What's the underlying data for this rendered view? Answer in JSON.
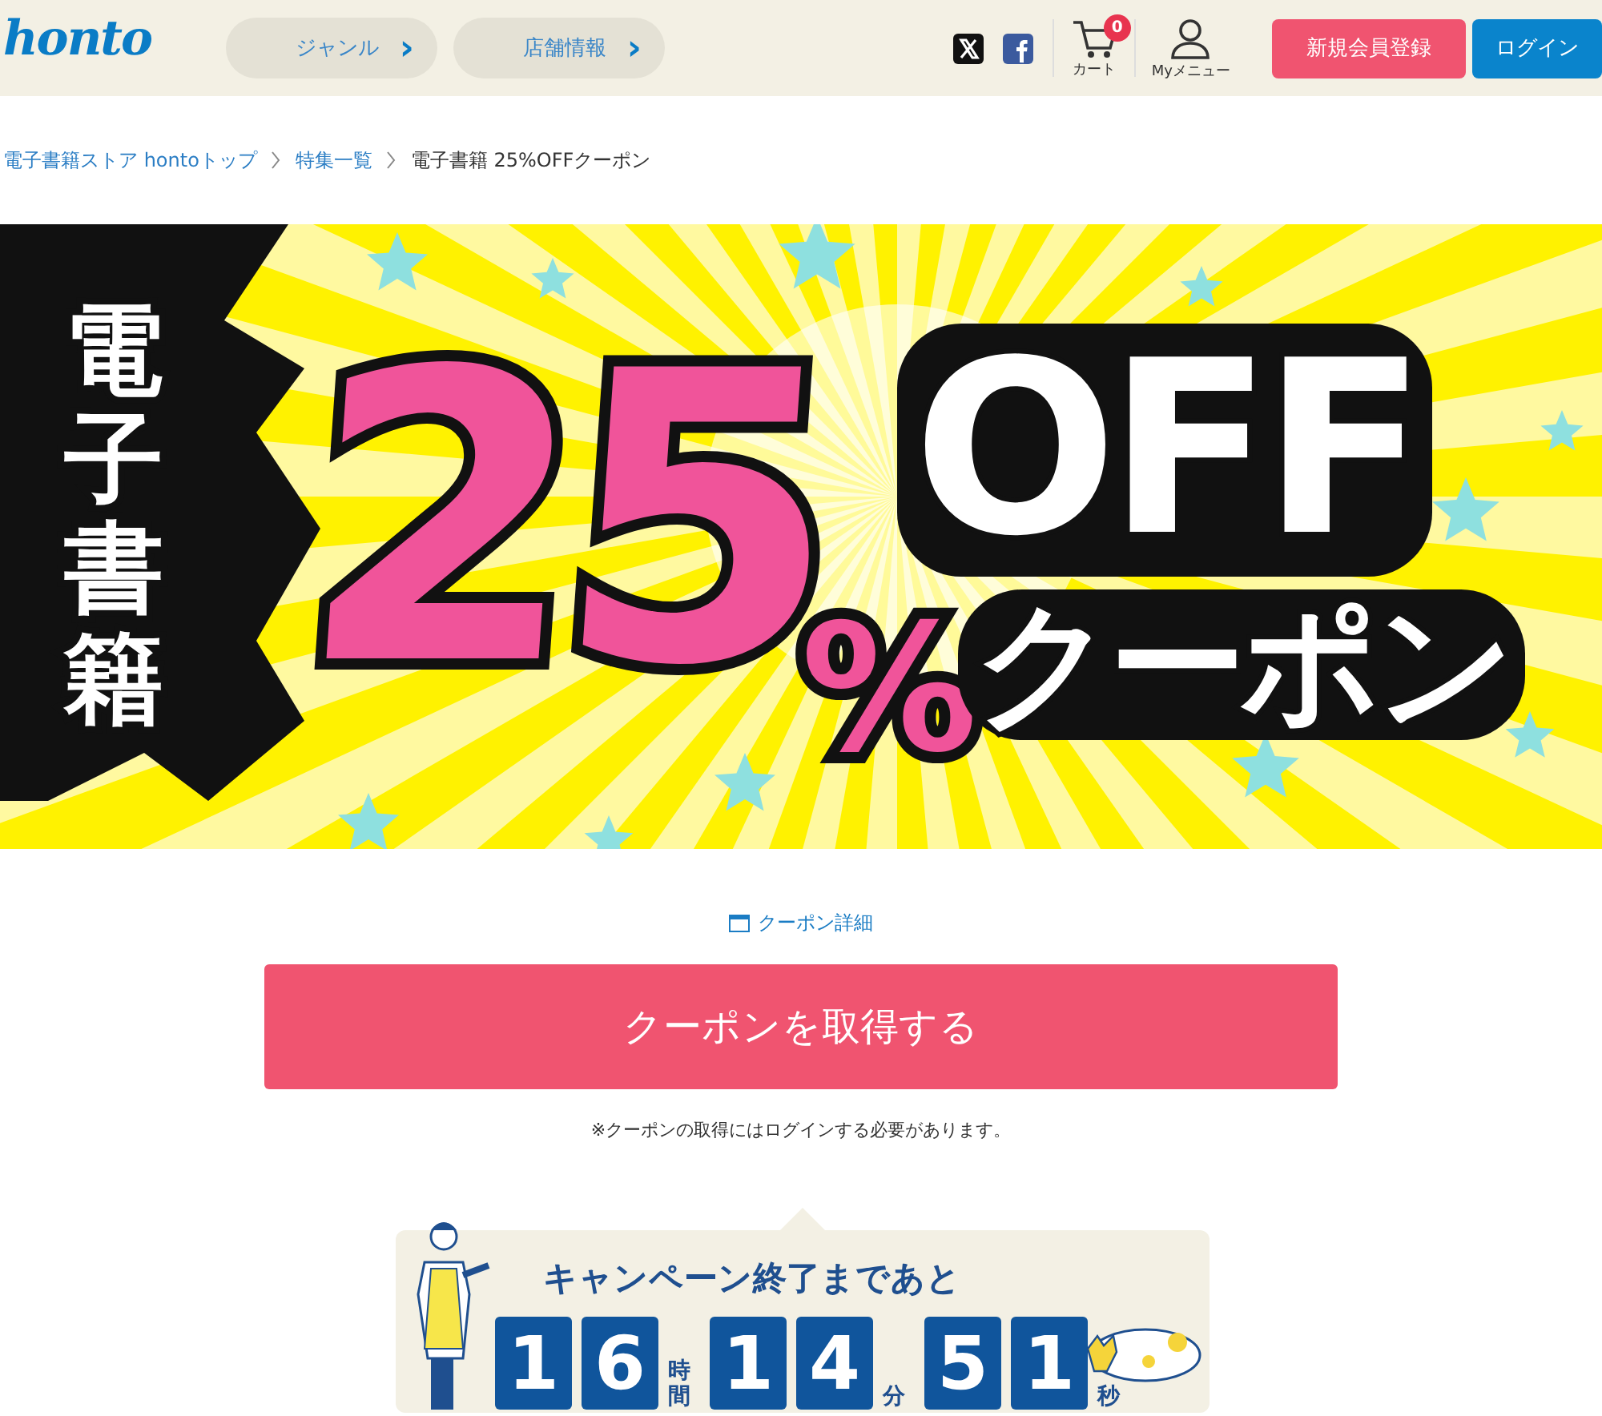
{
  "header": {
    "logo": "honto",
    "nav": [
      {
        "label": "ジャンル",
        "arrow": "›"
      },
      {
        "label": "店舗情報",
        "arrow": "›"
      }
    ],
    "cart": {
      "label": "カート",
      "count": "0"
    },
    "my_menu": {
      "label": "Myメニュー"
    },
    "buttons": [
      {
        "kind": "register",
        "label": "新規会員登録"
      },
      {
        "kind": "login",
        "label": "ログイン"
      }
    ]
  },
  "breadcrumb": [
    {
      "label": "電子書籍ストア hontoトップ",
      "link": true
    },
    {
      "label": "特集一覧",
      "link": true
    },
    {
      "label": "電子書籍 25%OFFクーポン",
      "link": false
    }
  ],
  "banner": {
    "vertical": "電子書籍",
    "number": "25",
    "percent": "%",
    "off": "OFF",
    "coupon": "クーポン"
  },
  "coupon_detail": "クーポン詳細",
  "get_button": "クーポンを取得する",
  "note": "※クーポンの取得にはログインする必要があります。",
  "countdown": {
    "title": "キャンペーン終了まであと",
    "units": [
      {
        "digits": [
          "1",
          "6"
        ],
        "label": "時間"
      },
      {
        "digits": [
          "1",
          "4"
        ],
        "label": "分"
      },
      {
        "digits": [
          "5",
          "1"
        ],
        "label": "秒"
      }
    ]
  }
}
